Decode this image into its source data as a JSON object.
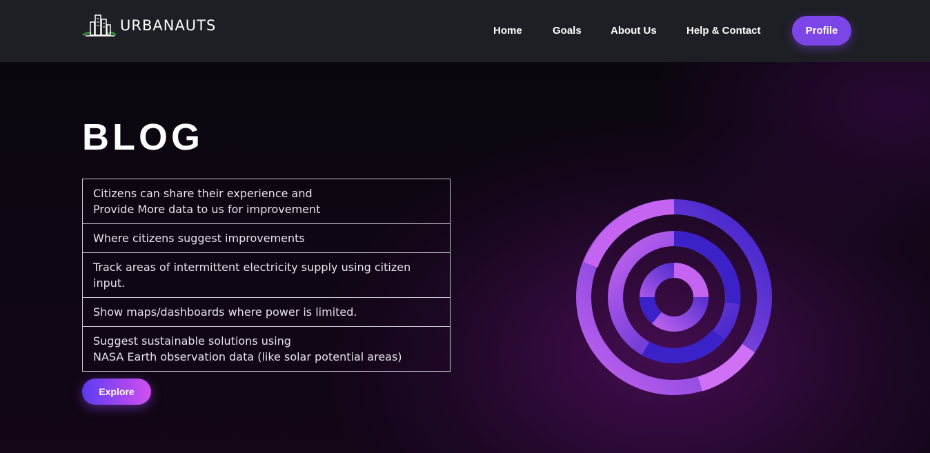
{
  "brand": {
    "name": "URBANAUTS"
  },
  "nav": {
    "links": [
      "Home",
      "Goals",
      "About Us",
      "Help & Contact"
    ],
    "profile_label": "Profile"
  },
  "hero": {
    "title": "BLOG",
    "features": [
      "Citizens can share their experience and\nProvide More data to us for improvement",
      "Where citizens suggest improvements",
      "Track areas of intermittent electricity supply using citizen\ninput.",
      "Show maps/dashboards where power is limited.",
      "Suggest sustainable solutions using\nNASA Earth observation data (like solar potential areas)"
    ],
    "explore_label": "Explore"
  },
  "colors": {
    "accent": "#7c45e8",
    "ring_blue": "#3a22c8",
    "ring_pink": "#c464f0",
    "navbar_bg": "#1e1e25"
  }
}
